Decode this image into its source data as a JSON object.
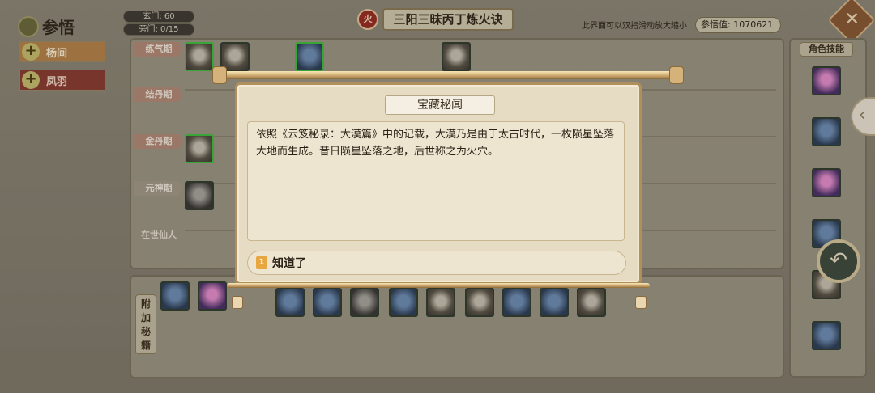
{
  "header": {
    "title": "参悟",
    "xuanmen_label": "玄门: 60",
    "pangmen_label": "旁门: 0/15",
    "skill_name": "三阳三昧丙丁炼火诀",
    "element_badge": "火",
    "hint": "此界面可以双指滑动放大缩小",
    "points_label": "参悟值: 1070621"
  },
  "sidebar": {
    "items": [
      {
        "label": "杨间",
        "active": true
      },
      {
        "label": "凤羽",
        "active": false
      }
    ]
  },
  "stages": [
    "练气期",
    "结丹期",
    "金丹期",
    "元神期",
    "在世仙人"
  ],
  "right_panel": {
    "title": "角色技能",
    "skills": [
      "skill-1",
      "skill-2",
      "skill-3",
      "skill-4",
      "skill-5",
      "skill-6"
    ]
  },
  "bottom_panel": {
    "label": "附加秘籍"
  },
  "modal": {
    "title": "宝藏秘闻",
    "body": "依照《云笈秘录：大漠篇》中的记载，大漠乃是由于太古时代，一枚陨星坠落大地而生成。昔日陨星坠落之地，后世称之为火穴。",
    "button_index": "1",
    "button_label": "知道了"
  },
  "colors": {
    "panel": "#9d9685",
    "paper": "#e6dcc4",
    "accent_gold": "#c9a36a",
    "active_tab": "#b88348",
    "inactive_tab": "#8a3a30",
    "fire_badge": "#9a2a22"
  }
}
